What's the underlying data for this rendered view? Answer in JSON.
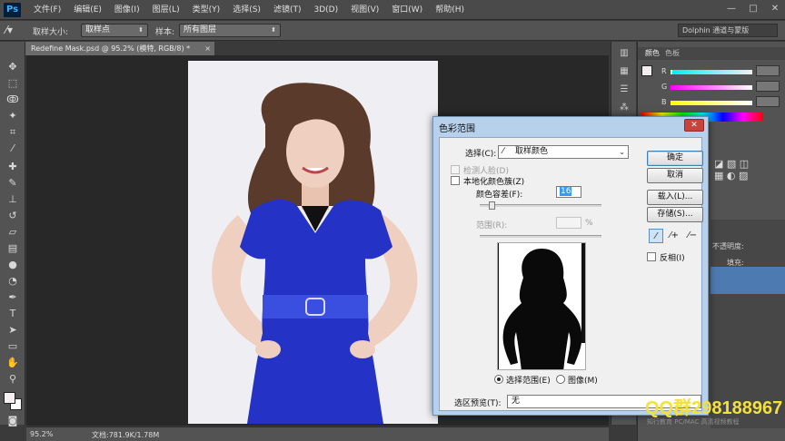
{
  "app": {
    "logo": "Ps"
  },
  "menu": [
    "文件(F)",
    "编辑(E)",
    "图像(I)",
    "图层(L)",
    "类型(Y)",
    "选择(S)",
    "滤镜(T)",
    "3D(D)",
    "视图(V)",
    "窗口(W)",
    "帮助(H)"
  ],
  "window_controls": [
    "—",
    "□",
    "✕"
  ],
  "options_bar": {
    "sample_size_label": "取样大小:",
    "sample_size_value": "取样点",
    "sample_label": "样本:",
    "sample_value": "所有图层",
    "workspace": "Dolphin 通道与蒙版"
  },
  "document": {
    "tab_title": "Redefine Mask.psd @ 95.2% (模特, RGB/8) *",
    "zoom": "95.2%",
    "info": "文档:781.9K/1.78M"
  },
  "right_panel": {
    "color_tab": "颜色",
    "swatches_tab": "色板",
    "rgb": [
      {
        "label": "R",
        "value": ""
      },
      {
        "label": "G",
        "value": ""
      },
      {
        "label": "B",
        "value": ""
      }
    ],
    "opacity_label": "不透明度:",
    "fill_label": "填充:"
  },
  "dialog": {
    "title": "色彩范围",
    "close": "✕",
    "select_label": "选择(C):",
    "select_value": "取样颜色",
    "detect_faces": "检测人脸(D)",
    "localized": "本地化颜色簇(Z)",
    "fuzziness_label": "颜色容差(F):",
    "fuzziness_value": "16",
    "range_label": "范围(R):",
    "range_unit": "%",
    "ok": "确定",
    "cancel": "取消",
    "load": "载入(L)...",
    "save": "存储(S)...",
    "invert": "反相(I)",
    "radio_selection": "选择范围(E)",
    "radio_image": "图像(M)",
    "preview_label": "选区预览(T):",
    "preview_value": "无"
  },
  "watermark": {
    "qq": "QQ群298188967",
    "site": "知行教育 PC/MAC 高清视频教程"
  },
  "colors": {
    "dress": "#2433c6",
    "hair": "#5a3a2a",
    "skin": "#efcfbf",
    "photo_bg": "#efeef3",
    "watermark_yellow": "#f4e13a"
  }
}
